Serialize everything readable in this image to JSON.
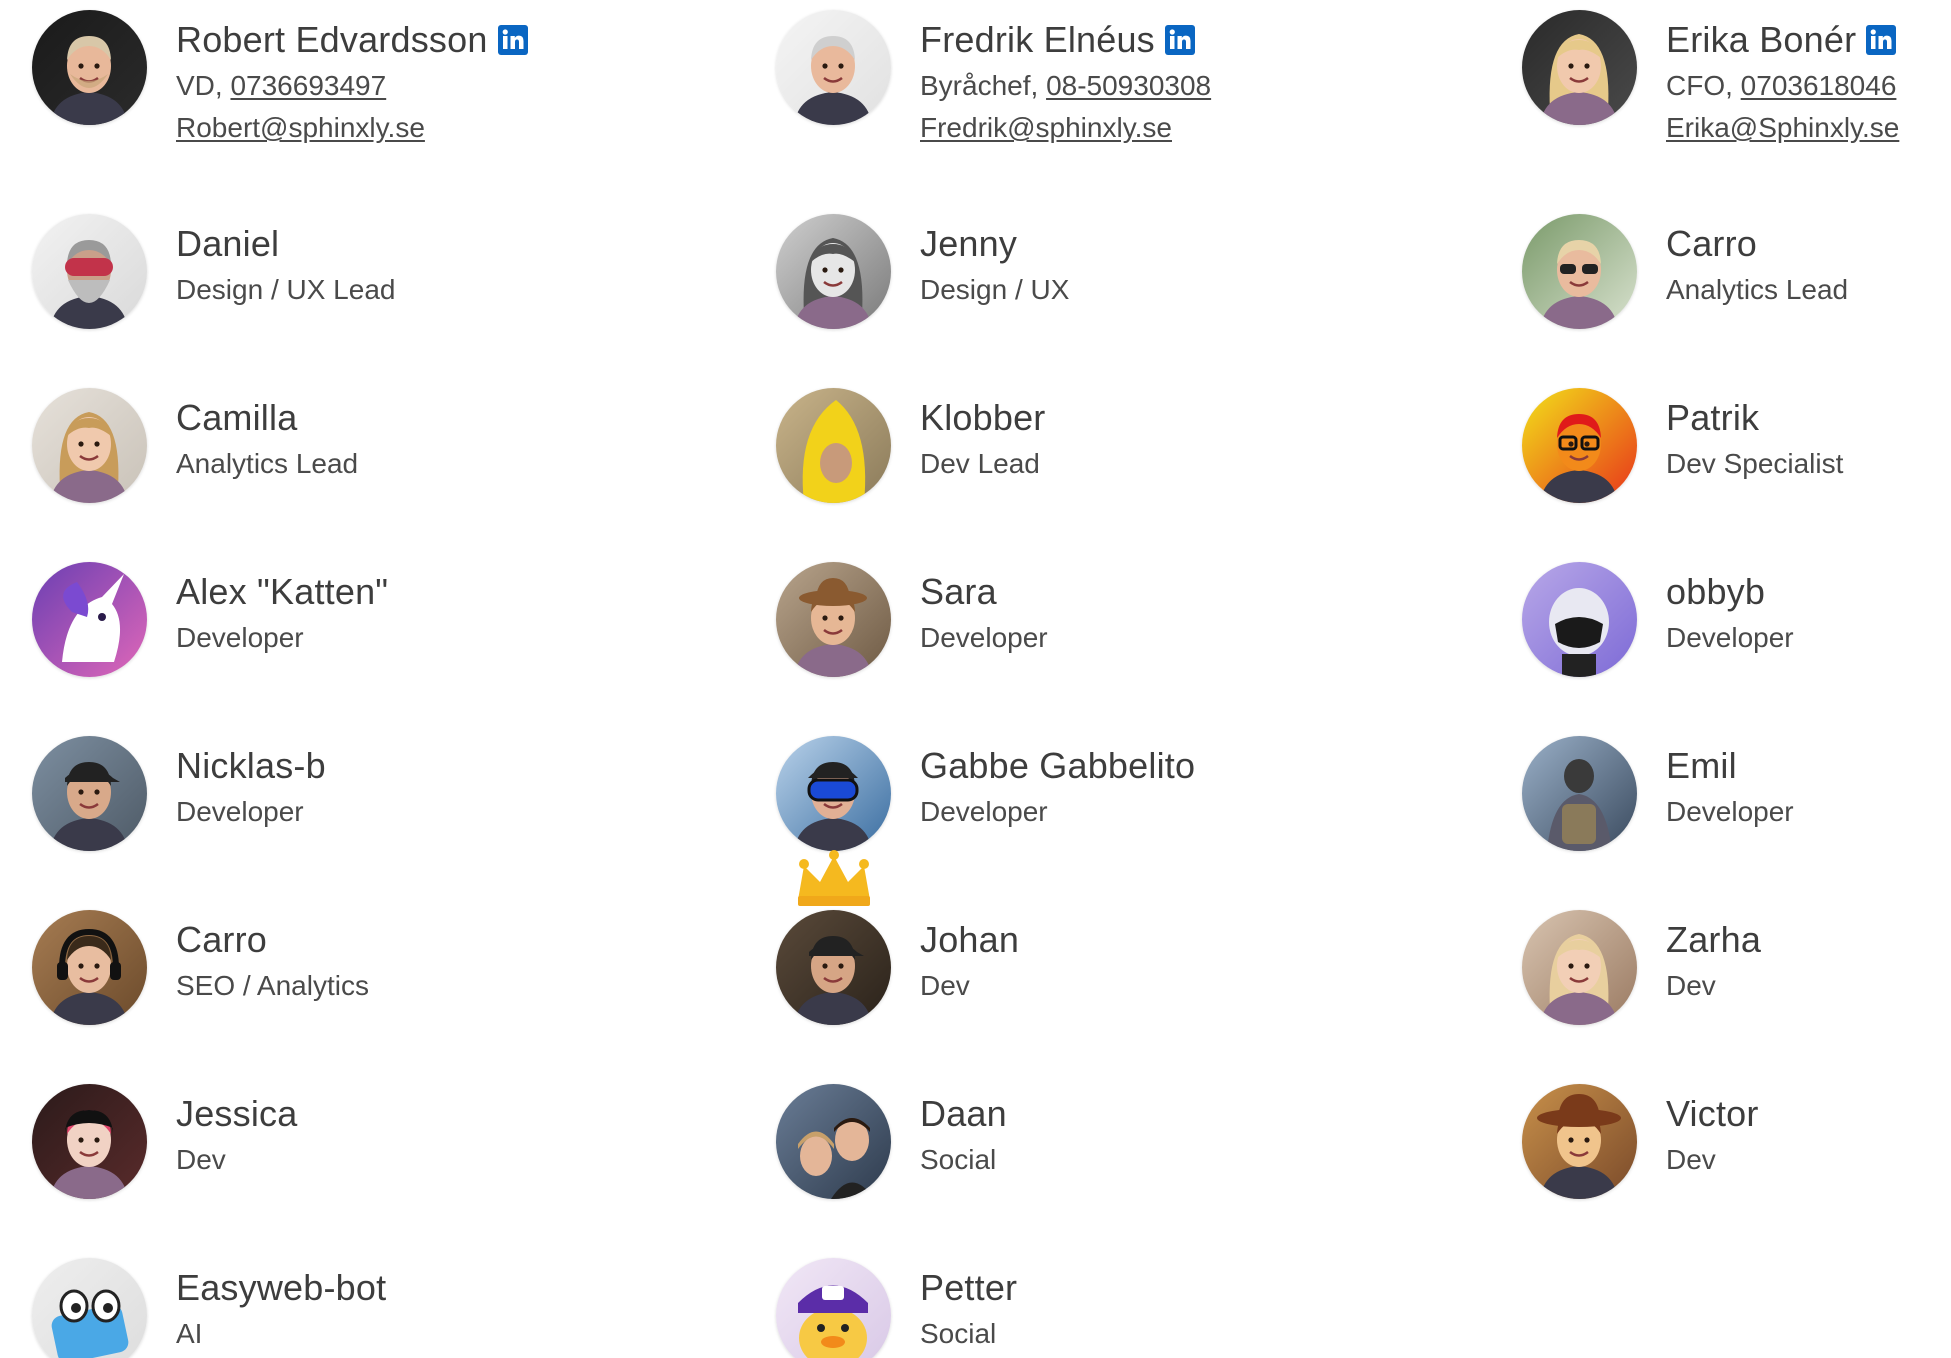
{
  "team": [
    [
      {
        "name": "Robert Edvardsson",
        "linkedin": true,
        "role": "VD",
        "phone": "0736693497",
        "email": "Robert@sphinxly.se",
        "avatar": "bearded-man-smiling-portrait"
      },
      {
        "name": "Daniel",
        "role": "Design / UX Lead",
        "avatar": "man-with-ski-goggles-and-beard"
      },
      {
        "name": "Camilla",
        "role": "Analytics Lead",
        "avatar": "woman-smiling-portrait"
      },
      {
        "name": "Alex \"Katten\"",
        "role": "Developer",
        "avatar": "unicorn-illustration"
      },
      {
        "name": "Nicklas-b",
        "role": "Developer",
        "avatar": "man-with-cap-portrait"
      },
      {
        "name": "Carro",
        "role": "SEO / Analytics",
        "avatar": "person-with-headphones"
      },
      {
        "name": "Jessica",
        "role": "Dev",
        "avatar": "woman-with-red-hair"
      },
      {
        "name": "Easyweb-bot",
        "role": "AI",
        "avatar": "robot-mascot"
      }
    ],
    [
      {
        "name": "Fredrik Elnéus",
        "linkedin": true,
        "role": "Byråchef",
        "phone": "08-50930308",
        "email": "Fredrik@sphinxly.se",
        "avatar": "grey-haired-man-portrait"
      },
      {
        "name": "Jenny",
        "role": "Design / UX",
        "avatar": "woman-black-and-white-portrait"
      },
      {
        "name": "Klobber",
        "role": "Dev Lead",
        "avatar": "person-in-banana-costume"
      },
      {
        "name": "Sara",
        "role": "Developer",
        "avatar": "woman-with-cowboy-hat-and-kangaroo"
      },
      {
        "name": "Gabbe Gabbelito",
        "role": "Developer",
        "avatar": "man-with-ski-goggles"
      },
      {
        "name": "Johan",
        "role": "Dev",
        "avatar": "man-with-cap-selfie",
        "crown": true
      },
      {
        "name": "Daan",
        "role": "Social",
        "avatar": "couple-selfie"
      },
      {
        "name": "Petter",
        "role": "Social",
        "avatar": "duck-mascot-with-cap"
      }
    ],
    [
      {
        "name": "Erika Bonér",
        "linkedin": true,
        "role": "CFO",
        "phone": "0703618046",
        "email": "Erika@Sphinxly.se",
        "avatar": "blonde-woman-portrait"
      },
      {
        "name": "Carro",
        "role": "Analytics Lead",
        "avatar": "woman-with-sunglasses"
      },
      {
        "name": "Patrik",
        "role": "Dev Specialist",
        "avatar": "colorful-pop-art-portrait"
      },
      {
        "name": "obbyb",
        "role": "Developer",
        "avatar": "robot-illustration-purple"
      },
      {
        "name": "Emil",
        "role": "Developer",
        "avatar": "man-with-backpack"
      },
      {
        "name": "Zarha",
        "role": "Dev",
        "avatar": "woman-mirror-selfie"
      },
      {
        "name": "Victor",
        "role": "Dev",
        "avatar": "cowboy-toy-character"
      }
    ]
  ],
  "colors": {
    "text": "#3d3d3d",
    "linkedin": "#0a66c2"
  }
}
